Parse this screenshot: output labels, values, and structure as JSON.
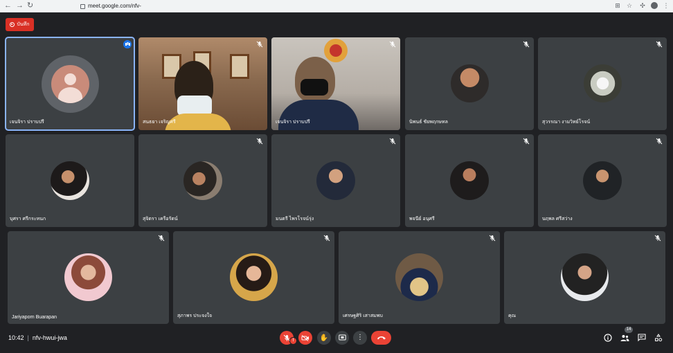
{
  "browser": {
    "url": "meet.google.com/nfv-hwui-jwa"
  },
  "recording": {
    "label": "บันทึก"
  },
  "participants": [
    {
      "name": "เจนจิรา ปราบปรี",
      "kind": "avatar",
      "muted": false,
      "speaking": true
    },
    {
      "name": "สนธยา เจริญศรี",
      "kind": "video",
      "muted": true
    },
    {
      "name": "เจนจิรา ปราบปรี",
      "kind": "video",
      "muted": true
    },
    {
      "name": "นิพนธ์ ชัยพฤกษทล",
      "kind": "photo",
      "muted": true
    },
    {
      "name": "สุวรรณา งามวิทย์โรจน์",
      "kind": "photo",
      "muted": true
    },
    {
      "name": "บุศรา ศรีกระหนก",
      "kind": "photo",
      "muted": false
    },
    {
      "name": "สุจิตรา เครือรัตน์",
      "kind": "photo",
      "muted": true
    },
    {
      "name": "มนตรี ไพรโรจน์รุ่ง",
      "kind": "photo",
      "muted": true
    },
    {
      "name": "พจนีย์ อนุศรี",
      "kind": "photo",
      "muted": true
    },
    {
      "name": "นฤพล ศรีสว่าง",
      "kind": "photo",
      "muted": true
    },
    {
      "name": "Jariyaporn Buarapan",
      "kind": "photo",
      "muted": true
    },
    {
      "name": "สุภาพร ประจงใจ",
      "kind": "photo",
      "muted": true
    },
    {
      "name": "เศรษฐศิริ เสาสมพบ",
      "kind": "photo",
      "muted": true
    },
    {
      "name": "คุณ",
      "kind": "photo",
      "muted": true
    }
  ],
  "bottom_bar": {
    "time": "10:42",
    "separator": "|",
    "meeting_code": "nfv-hwui-jwa",
    "participant_count": "14",
    "warning": "!"
  },
  "colors": {
    "background": "#202124",
    "tile": "#3c4043",
    "danger": "#ea4335",
    "active_outline": "#8ab4f8"
  }
}
